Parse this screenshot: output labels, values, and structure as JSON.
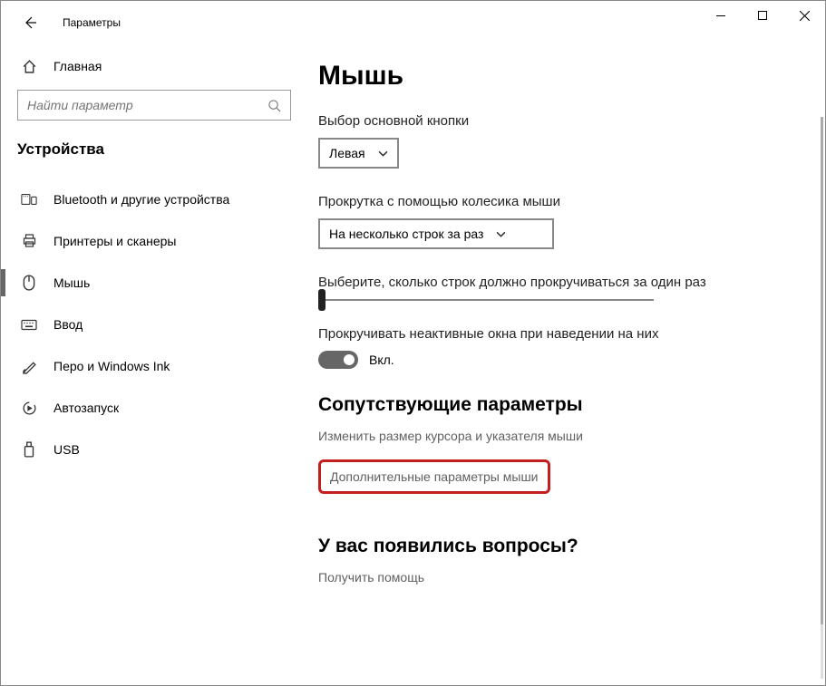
{
  "window": {
    "title": "Параметры"
  },
  "sidebar": {
    "home_label": "Главная",
    "search_placeholder": "Найти параметр",
    "category": "Устройства",
    "items": [
      {
        "label": "Bluetooth и другие устройства"
      },
      {
        "label": "Принтеры и сканеры"
      },
      {
        "label": "Мышь"
      },
      {
        "label": "Ввод"
      },
      {
        "label": "Перо и Windows Ink"
      },
      {
        "label": "Автозапуск"
      },
      {
        "label": "USB"
      }
    ]
  },
  "main": {
    "page_title": "Мышь",
    "primary_button": {
      "label": "Выбор основной кнопки",
      "value": "Левая"
    },
    "scroll_mode": {
      "label": "Прокрутка с помощью колесика мыши",
      "value": "На несколько строк за раз"
    },
    "lines_per_scroll": {
      "label": "Выберите, сколько строк должно прокручиваться за один раз"
    },
    "inactive_hover": {
      "label": "Прокручивать неактивные окна при наведении на них",
      "state_label": "Вкл."
    },
    "related": {
      "heading": "Сопутствующие параметры",
      "link_cursor": "Изменить размер курсора и указателя мыши",
      "link_additional": "Дополнительные параметры мыши"
    },
    "help": {
      "heading": "У вас появились вопросы?",
      "link": "Получить помощь"
    }
  }
}
